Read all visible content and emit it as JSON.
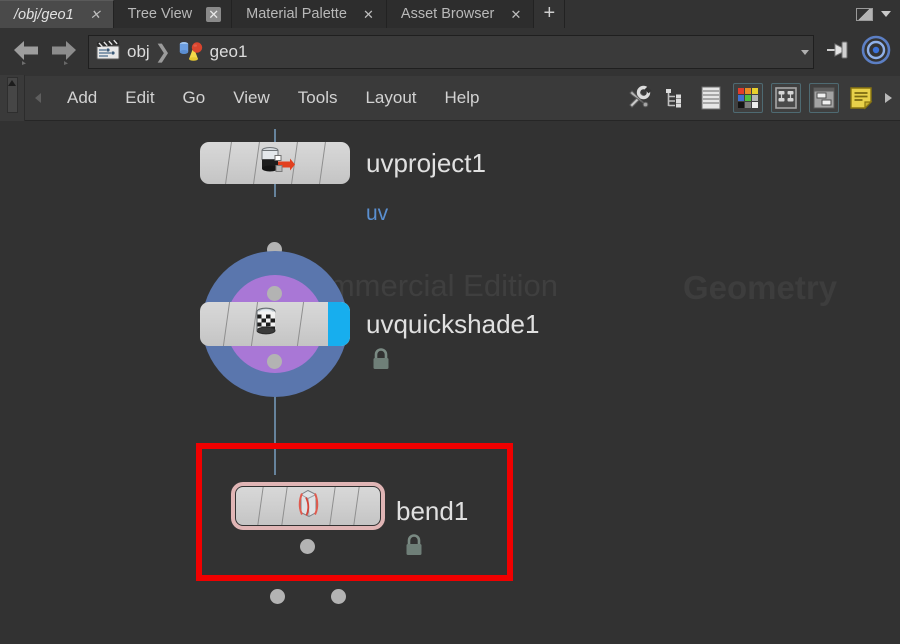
{
  "window": {
    "maximize_glyph": "maximize-icon",
    "menu_caret": "caret-down-icon"
  },
  "tabs": {
    "items": [
      {
        "label": "/obj/geo1",
        "active": true,
        "close": "✕"
      },
      {
        "label": "Tree View",
        "active": false,
        "close": "✕"
      },
      {
        "label": "Material Palette",
        "active": false,
        "close": "✕"
      },
      {
        "label": "Asset Browser",
        "active": false,
        "close": "✕"
      }
    ],
    "add_label": "+"
  },
  "pathbar": {
    "back_icon": "back-arrow-icon",
    "forward_icon": "forward-arrow-icon",
    "crumbs": [
      {
        "icon": "clapperboard-icon",
        "label": "obj"
      },
      {
        "icon": "geometry-objects-icon",
        "label": "geo1"
      }
    ],
    "separator": "❯",
    "dropdown_icon": "caret-down-icon",
    "pin_icon": "pin-icon",
    "target_icon": "target-icon"
  },
  "menubar": {
    "scroll_left_icon": "scroll-left-icon",
    "items": [
      {
        "label": "Add"
      },
      {
        "label": "Edit"
      },
      {
        "label": "Go"
      },
      {
        "label": "View"
      },
      {
        "label": "Tools"
      },
      {
        "label": "Layout"
      },
      {
        "label": "Help"
      }
    ],
    "tools": [
      {
        "name": "tools-wrench-icon",
        "framed": false
      },
      {
        "name": "tree-list-icon",
        "framed": false
      },
      {
        "name": "list-view-icon",
        "framed": false
      },
      {
        "name": "color-palette-icon",
        "framed": true
      },
      {
        "name": "node-layout-icon",
        "framed": true
      },
      {
        "name": "panes-layout-icon",
        "framed": true
      },
      {
        "name": "sticky-note-icon",
        "framed": false
      }
    ],
    "more_icon": "more-arrow-icon"
  },
  "network": {
    "watermarks": [
      {
        "id": "noncommercial",
        "text": "Non-Commercial Edition"
      },
      {
        "id": "geometry",
        "text": "Geometry"
      }
    ],
    "nodes": [
      {
        "id": "uvproject1",
        "name": "uvproject1",
        "icon": "uvproject-icon",
        "selected": false,
        "locked": false,
        "badge": "uv",
        "badge_color": "#5a8fd0"
      },
      {
        "id": "uvquickshade1",
        "name": "uvquickshade1",
        "icon": "uvquickshade-icon",
        "selected": false,
        "locked": true,
        "lock_icon": "lock-icon",
        "display_flag_color": "#5a76ad",
        "render_flag_color": "#a977d6",
        "template_flag_color": "#17aeee"
      },
      {
        "id": "bend1",
        "name": "bend1",
        "icon": "bend-icon",
        "selected": true,
        "locked": true,
        "lock_icon": "lock-icon",
        "highlight_color": "#ff0000"
      }
    ],
    "wire_color": "#66839c",
    "connector_color": "#b3b3b3"
  }
}
